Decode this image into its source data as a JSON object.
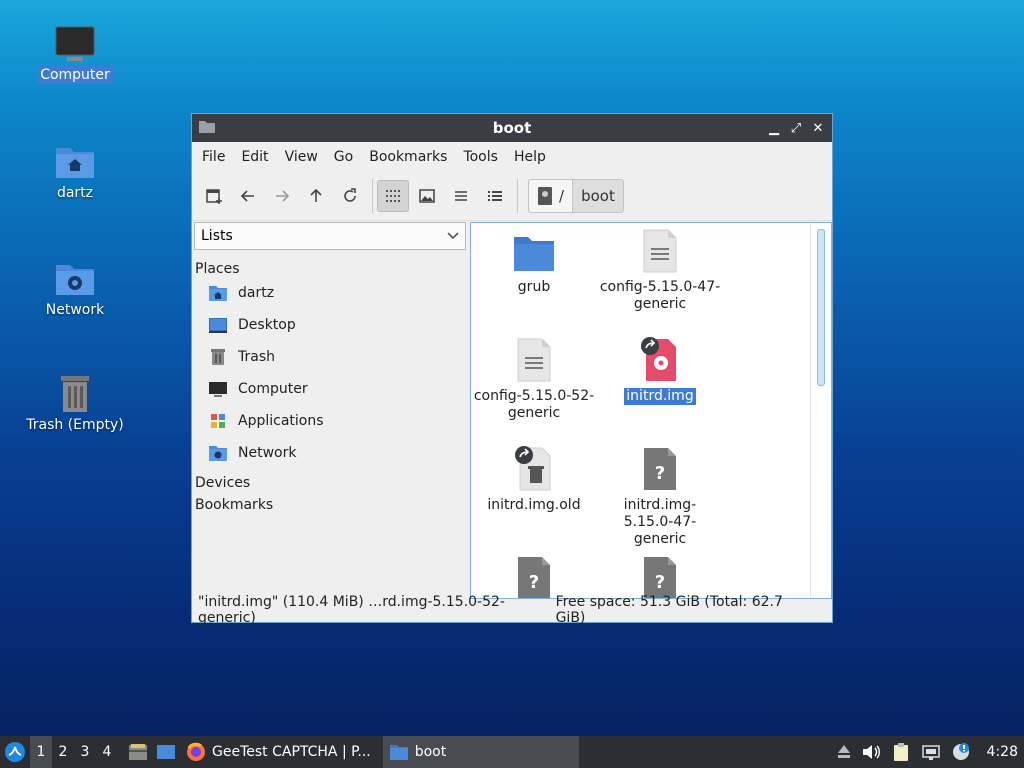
{
  "desktop": {
    "icons": [
      {
        "label": "Computer",
        "icon": "computer-icon"
      },
      {
        "label": "dartz",
        "icon": "home-folder-icon"
      },
      {
        "label": "Network",
        "icon": "network-folder-icon"
      },
      {
        "label": "Trash (Empty)",
        "icon": "trash-icon"
      }
    ]
  },
  "window": {
    "title": "boot",
    "menu": [
      "File",
      "Edit",
      "View",
      "Go",
      "Bookmarks",
      "Tools",
      "Help"
    ],
    "path": {
      "root": "/",
      "current": "boot"
    },
    "side": {
      "combo": "Lists",
      "places_header": "Places",
      "places": [
        {
          "label": "dartz",
          "icon": "home-folder-icon"
        },
        {
          "label": "Desktop",
          "icon": "desktop-icon"
        },
        {
          "label": "Trash",
          "icon": "trash-icon"
        },
        {
          "label": "Computer",
          "icon": "computer-icon"
        },
        {
          "label": "Applications",
          "icon": "applications-icon"
        },
        {
          "label": "Network",
          "icon": "network-folder-icon"
        }
      ],
      "devices_header": "Devices",
      "bookmarks_header": "Bookmarks"
    },
    "files": [
      {
        "name": "grub",
        "icon": "folder-icon"
      },
      {
        "name": "config-5.15.0-47-generic",
        "icon": "text-file-icon"
      },
      {
        "name": "config-5.15.0-52-generic",
        "icon": "text-file-icon"
      },
      {
        "name": "initrd.img",
        "icon": "disk-image-link-icon"
      },
      {
        "name": "initrd.img.old",
        "icon": "file-link-icon"
      },
      {
        "name": "initrd.img-5.15.0-47-generic",
        "icon": "unknown-file-icon"
      },
      {
        "name": "",
        "icon": "unknown-file-icon"
      },
      {
        "name": "",
        "icon": "unknown-file-icon"
      }
    ],
    "status": {
      "left": "\"initrd.img\" (110.4 MiB) …rd.img-5.15.0-52-generic)",
      "right": "Free space: 51.3 GiB (Total: 62.7 GiB)"
    }
  },
  "taskbar": {
    "workspaces": [
      "1",
      "2",
      "3",
      "4"
    ],
    "tasks": [
      {
        "label": "GeeTest CAPTCHA | P...",
        "icon": "firefox-icon"
      },
      {
        "label": "boot",
        "icon": "folder-icon"
      }
    ],
    "clock": "4:28"
  },
  "colors": {
    "accent": "#3d7bd6",
    "titlebar": "#3a3e44",
    "folder": "#4a8ad8"
  }
}
